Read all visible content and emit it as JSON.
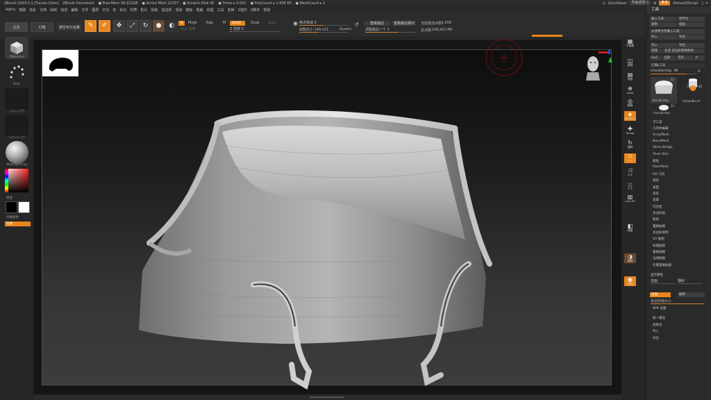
{
  "titlebar": {
    "app_title": "ZBrush 2024.0.1 [Tianao Chen]",
    "document": "ZBrush Document",
    "free_mem": "● Free Mem 39.312GB",
    "active_mem": "● Active Mem 12157",
    "scratch": "● Scratch Disk 45",
    "timer": "● Timer ▸ 0.001",
    "polycount": "● PolyCount ▸ 1.658 KP",
    "meshcount": "● MeshCount ▸ 1",
    "quicksave": "QuickSave",
    "transparency": "界面透明 0",
    "menu_btn": "菜单",
    "script": "DefaultZScript"
  },
  "menubar": {
    "items": [
      "Alpha",
      "笔刷",
      "色彩",
      "文档",
      "绘制",
      "动态",
      "编辑",
      "文件",
      "图层",
      "灯光",
      "宏",
      "标记",
      "材质",
      "影片",
      "拾取",
      "首选项",
      "渲染",
      "模板",
      "笔触",
      "纹理",
      "工具",
      "变换",
      "Z插件",
      "Z脚本",
      "帮助"
    ]
  },
  "top_shelf": {
    "home": "主页",
    "lightbox": "灯箱",
    "live_boolean": "镂空布尔运算",
    "edit": "Edit",
    "draw": "Draw",
    "move": "Move",
    "scale": "Scale",
    "rotate": "Rotate",
    "mode_a": "A",
    "mrgb": "Mrgb",
    "rgb": "Rgb",
    "m": "M",
    "zadd": "Zadd",
    "zsub": "Zsub",
    "zcut": "Zcut",
    "rgb_intensity": "Rgb 强度",
    "z_intensity_label": "Z 强度",
    "z_intensity_value": "0",
    "focal_shift_label": "焦点衰减",
    "focal_shift_value": "0",
    "draw_size_label": "绘制大小",
    "draw_size_value": "149.121",
    "dynamic": "Dynamic",
    "redo_last": "重做最后",
    "redo_last_rel": "重做最后相对",
    "adjust_last_label": "调整最后一个",
    "adjust_last_value": "1",
    "active_points_label": "当前激活点数:",
    "active_points_value": "1,658",
    "total_points_label": "总点数:",
    "total_points_value": "168,921 Mil"
  },
  "left_shelf": {
    "brush": "ZModeler",
    "stroke": "Dots",
    "alpha": "Alpha Off",
    "texture": "Texture Off",
    "material": "MatCap Gray",
    "gradient": "渐变",
    "switch_color": "切换颜色",
    "alternate": "交替"
  },
  "right_shelf": [
    "子像素",
    "透视",
    "地面",
    "Local",
    "轴线",
    "Dynamic",
    "Ssnap",
    "旋转",
    "X Y",
    "X Z",
    "Y Z",
    "Line Fill",
    "视图",
    "透明",
    "独显"
  ],
  "tool_panel": {
    "title": "工具",
    "load_tool": "载入工具",
    "save_as": "另存为",
    "copy": "复制",
    "paste": "粘贴",
    "copy_from_project": "从项目文件载入工具",
    "import": "导入",
    "export": "导出",
    "clone": "克隆",
    "make_polymesh": "生成 多边形网格物体",
    "goz": "GoZ",
    "all": "全部",
    "visible": "可见",
    "r": "R",
    "lightbox_tools": "灯箱▸工具",
    "current_tool": "shouldertop. 48",
    "r_count": "R",
    "thumbs": [
      {
        "name": "shouldertop",
        "badge": "12"
      },
      {
        "name": "Cylinder3D",
        "badge": ""
      },
      {
        "name": "SimpleBrush",
        "badge": ""
      },
      {
        "name": "shouldertop",
        "badge": "34"
      }
    ],
    "menu": [
      "子工具",
      "几何体编辑",
      "ArrayMesh",
      "NanoMesh",
      "Slime Bridge",
      "Thick Skin",
      "图层",
      "FiberMesh",
      "HD 几何",
      "预览",
      "表面",
      "变形",
      "遮罩",
      "可见性",
      "多边形组",
      "联系",
      "置换贴图",
      "多边形绘制",
      "UV 贴图",
      "纹理贴图",
      "置换贴图",
      "法线贴图",
      "矢量置换贴图"
    ],
    "display_props": "显示属性",
    "double": "双面",
    "flip": "翻转",
    "displace_res": "多边形组大小",
    "bpr": "BPR 设置",
    "bottom_items": [
      "统一重设",
      "初始化",
      "导入",
      "导出"
    ]
  }
}
